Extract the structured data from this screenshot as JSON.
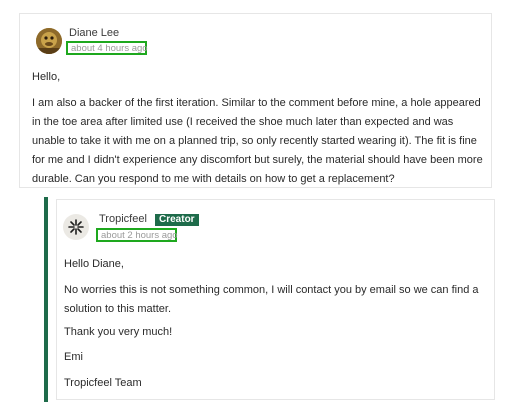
{
  "comment": {
    "author": "Diane Lee",
    "timestamp": "about 4 hours ago",
    "greeting": "Hello,",
    "body": "I am also a backer of the first iteration. Similar to the comment before mine, a hole appeared in the toe area after limited use (I received the shoe much later than expected and was unable to take it with me on a planned trip, so only recently started wearing it). The fit is fine for me and I didn't experience any discomfort but surely, the material should have been more durable. Can you respond to me with details on how to get a replacement?"
  },
  "reply": {
    "author": "Tropicfeel",
    "badge": "Creator",
    "timestamp": "about 2 hours ago",
    "greeting": "Hello Diane,",
    "body": "No worries this is not something common, I will contact you by email so we can find a solution to this matter.",
    "thanks": "Thank you very much!",
    "name": "Emi",
    "signature": "Tropicfeel Team"
  },
  "colors": {
    "accent_green": "#1e6b4a",
    "highlight_box": "#1ea81e",
    "timestamp_text": "#9a9a9a"
  },
  "icons": {
    "diane_avatar": "avatar-photo",
    "tropicfeel_avatar": "tropicfeel-logo-icon"
  }
}
